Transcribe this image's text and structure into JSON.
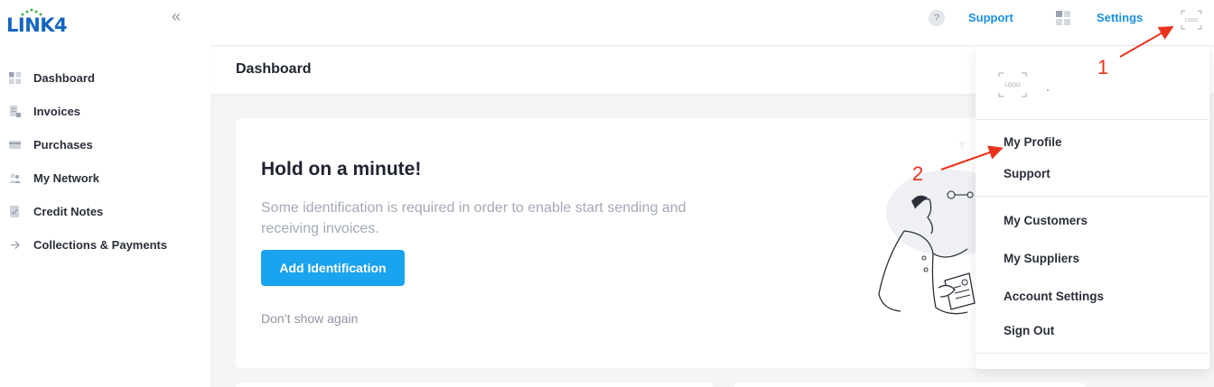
{
  "brand": {
    "name": "LINK4"
  },
  "sidebar": {
    "items": [
      {
        "label": "Dashboard",
        "icon": "dashboard-icon"
      },
      {
        "label": "Invoices",
        "icon": "invoice-icon"
      },
      {
        "label": "Purchases",
        "icon": "card-icon"
      },
      {
        "label": "My Network",
        "icon": "network-icon"
      },
      {
        "label": "Credit Notes",
        "icon": "credit-note-icon"
      },
      {
        "label": "Collections & Payments",
        "icon": "arrow-right-icon"
      }
    ]
  },
  "topbar": {
    "help": "?",
    "support": "Support",
    "settings": "Settings",
    "avatar_text": "LOGO"
  },
  "page": {
    "title": "Dashboard"
  },
  "card": {
    "title": "Hold on a minute!",
    "description": "Some identification is required in order to enable start sending and receiving invoices.",
    "button": "Add Identification",
    "dont_show": "Don’t show again"
  },
  "dropdown": {
    "logo_text": "LOGO",
    "items": [
      "My Profile",
      "Support",
      "My Customers",
      "My Suppliers",
      "Account Settings",
      "Sign Out"
    ]
  },
  "annotations": {
    "first": "1",
    "second": "2"
  },
  "colors": {
    "accent": "#1aa3ef",
    "link": "#1b8fe0",
    "brand": "#1565c0",
    "annotation": "#e8331c"
  }
}
